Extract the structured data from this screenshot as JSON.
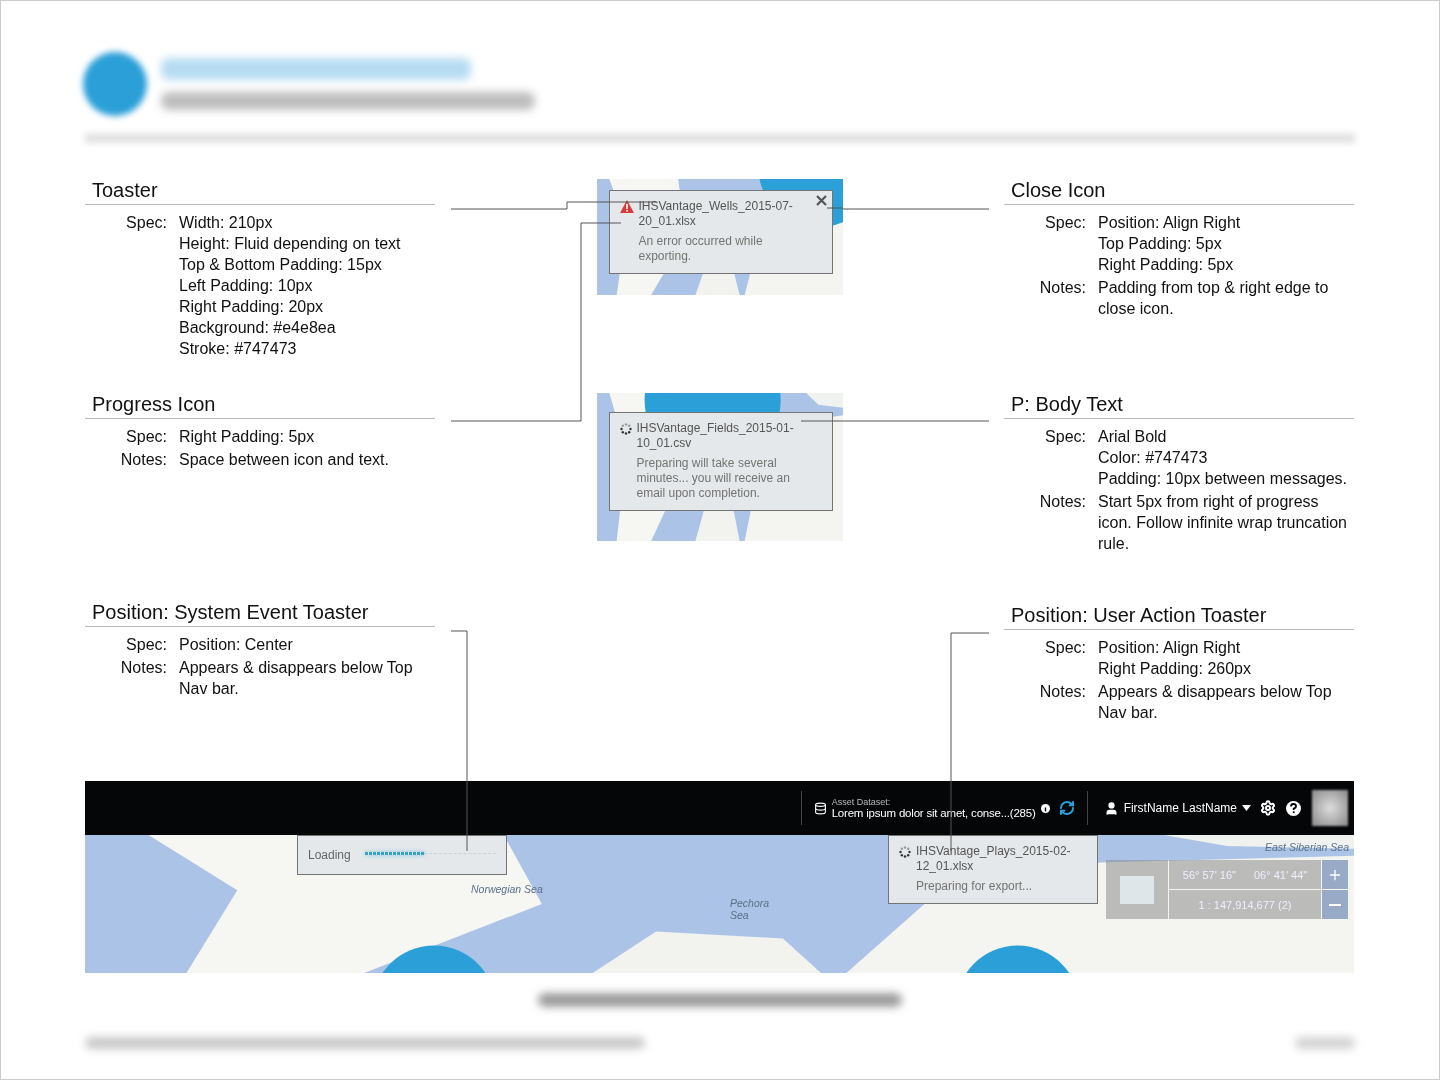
{
  "left_sections": [
    {
      "title": "Toaster",
      "rows": [
        {
          "label": "Spec:",
          "lines": [
            "Width: 210px",
            "Height: Fluid depending on text",
            "Top & Bottom Padding: 15px",
            "Left Padding: 10px",
            "Right Padding: 20px",
            "Background: #e4e8ea",
            "Stroke: #747473"
          ]
        }
      ]
    },
    {
      "title": "Progress Icon",
      "rows": [
        {
          "label": "Spec:",
          "lines": [
            "Right Padding: 5px"
          ]
        },
        {
          "label": "Notes:",
          "lines": [
            "Space between icon and text."
          ]
        }
      ]
    },
    {
      "title": "Position: System Event Toaster",
      "rows": [
        {
          "label": "Spec:",
          "lines": [
            "Position: Center"
          ]
        },
        {
          "label": "Notes:",
          "lines": [
            "Appears & disappears below Top Nav bar."
          ]
        }
      ]
    }
  ],
  "toasters": [
    {
      "kind": "error",
      "file": "IHSVantage_Wells_2015-07-20_01.xlsx",
      "message": "An error occurred while exporting.",
      "closable": true
    },
    {
      "kind": "progress",
      "file": "IHSVantage_Fields_2015-01-10_01.csv",
      "message": "Preparing will take several minutes... you will receive an email upon completion.",
      "closable": false
    }
  ],
  "right_sections": [
    {
      "title": "Close Icon",
      "rows": [
        {
          "label": "Spec:",
          "lines": [
            "Position: Align Right",
            "Top Padding: 5px",
            "Right Padding: 5px"
          ]
        },
        {
          "label": "Notes:",
          "lines": [
            "Padding from top & right edge to close icon."
          ]
        }
      ]
    },
    {
      "title": "P: Body Text",
      "rows": [
        {
          "label": "Spec:",
          "lines": [
            "Arial Bold",
            "Color: #747473",
            "Padding: 10px between messages."
          ]
        },
        {
          "label": "Notes:",
          "lines": [
            "Start 5px from right of progress icon. Follow infinite wrap truncation rule."
          ]
        }
      ]
    },
    {
      "title": "Position: User Action Toaster",
      "rows": [
        {
          "label": "Spec:",
          "lines": [
            "Position: Align Right",
            "Right Padding: 260px"
          ]
        },
        {
          "label": "Notes:",
          "lines": [
            "Appears & disappears below Top Nav bar."
          ]
        }
      ]
    }
  ],
  "app_preview": {
    "nav": {
      "asset_label": "Asset Dataset:",
      "asset_value": "Lorem ipsum dolor sit amet, conse...(285)",
      "user_name": "FirstName LastName"
    },
    "map_labels": [
      "Norwegian Sea",
      "Pechora Sea",
      "East Siberian Sea"
    ],
    "loading_toaster": {
      "label": "Loading",
      "level": 0.45
    },
    "export_toaster": {
      "kind": "progress",
      "file": "IHSVantage_Plays_2015-02-12_01.xlsx",
      "message": "Preparing for export..."
    },
    "map_controls": {
      "latitude": "56° 57' 16\"",
      "longitude": "06° 41' 44\"",
      "scale": "1 : 147,914,677 (2)"
    }
  }
}
